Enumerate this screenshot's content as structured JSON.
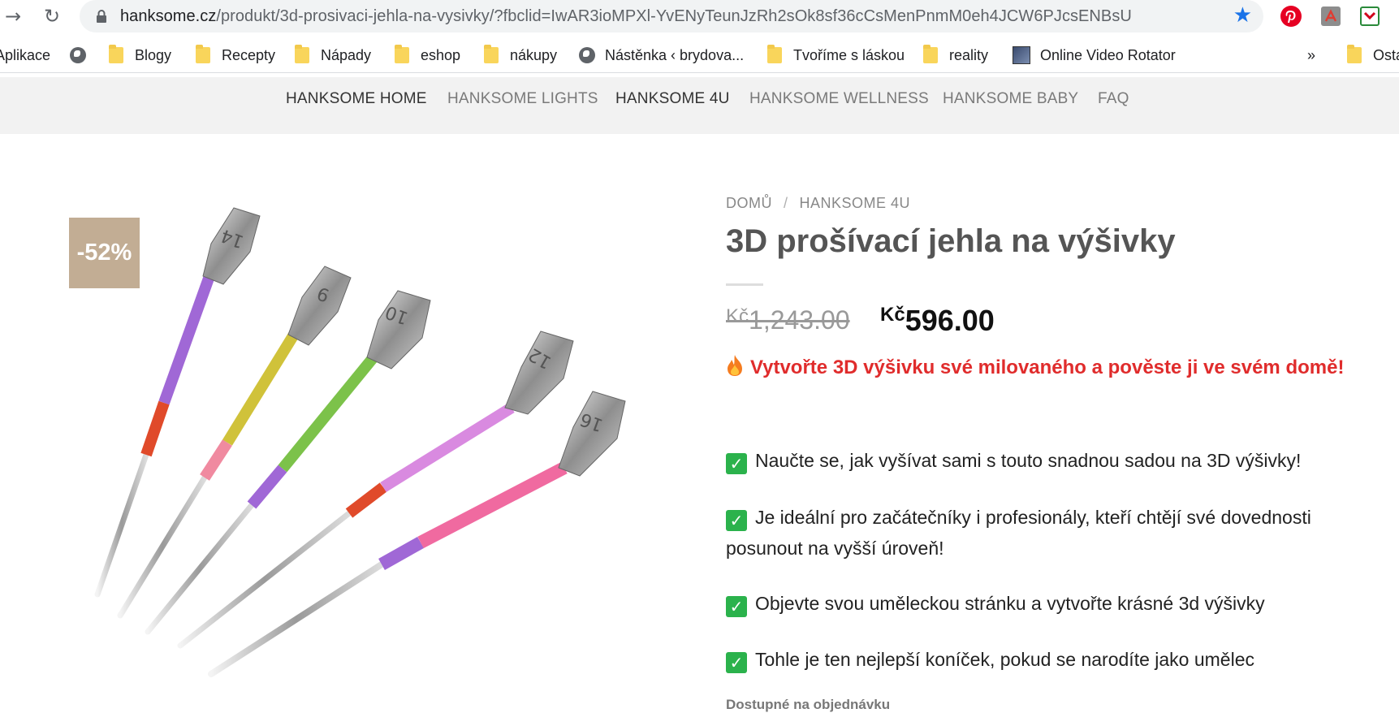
{
  "browser": {
    "url_host": "hanksome.cz",
    "url_path": "/produkt/3d-prosivaci-jehla-na-vysivky/?fbclid=IwAR3ioMPXl-YvENyTeunJzRh2sOk8sf36cCsMenPnmM0eh4JCW6PJcsENBsU",
    "bookmarks": [
      {
        "label": "Aplikace",
        "icon": "apps-grid-icon"
      },
      {
        "label": "",
        "icon": "globe-icon"
      },
      {
        "label": "Blogy",
        "icon": "folder-icon"
      },
      {
        "label": "Recepty",
        "icon": "folder-icon"
      },
      {
        "label": "Nápady",
        "icon": "folder-icon"
      },
      {
        "label": "eshop",
        "icon": "folder-icon"
      },
      {
        "label": "nákupy",
        "icon": "folder-icon"
      },
      {
        "label": "Nástěnka ‹ brydova...",
        "icon": "globe-icon"
      },
      {
        "label": "Tvoříme s láskou",
        "icon": "folder-icon"
      },
      {
        "label": "reality",
        "icon": "folder-icon"
      },
      {
        "label": "Online Video Rotator",
        "icon": "video-rotator-icon"
      },
      {
        "label": "»",
        "icon": "overflow-chevron-icon"
      },
      {
        "label": "Ostatn",
        "icon": "folder-icon"
      }
    ]
  },
  "site_nav": {
    "items": [
      {
        "label": "HANKSOME HOME",
        "active": true
      },
      {
        "label": "HANKSOME LIGHTS",
        "active": false
      },
      {
        "label": "HANKSOME 4U",
        "active": true
      },
      {
        "label": "HANKSOME WELLNESS",
        "active": false
      },
      {
        "label": "HANKSOME BABY",
        "active": false
      },
      {
        "label": "FAQ",
        "active": false
      }
    ]
  },
  "product": {
    "badge": "-52%",
    "breadcrumb": [
      "DOMŮ",
      "HANKSOME 4U"
    ],
    "title": "3D prošívací jehla na výšivky",
    "currency": "Kč",
    "old_price": "1,243.00",
    "new_price": "596.00",
    "promo": "Vytvořte 3D výšivku své milovaného a pověste ji ve svém domě!",
    "features": [
      "Naučte se, jak vyšívat sami s touto snadnou sadou na 3D výšivky!",
      "Je ideální pro začátečníky i profesionály, kteří chtějí své dovednosti posunout na vyšší úroveň!",
      "Objevte svou uměleckou stránku a vytvořte krásné 3d výšivky",
      "Tohle je ten nejlepší koníček, pokud se narodíte jako umělec"
    ],
    "availability": "Dostupné na objednávku",
    "needle_numbers": [
      "14",
      "9",
      "10",
      "12",
      "16"
    ]
  },
  "colors": {
    "badge_bg": "#c2ad94",
    "promo_red": "#e02c2c",
    "nav_bg": "#f2f2f2",
    "check_green": "#2bb24c",
    "star_blue": "#1a73e8"
  }
}
